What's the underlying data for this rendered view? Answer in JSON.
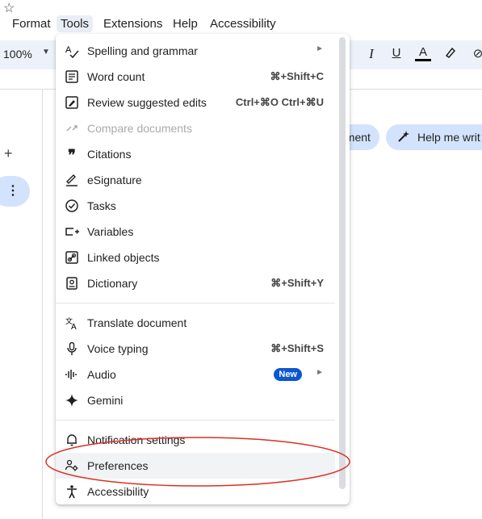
{
  "menubar": {
    "items": [
      {
        "label": "Format"
      },
      {
        "label": "Tools"
      },
      {
        "label": "Extensions"
      },
      {
        "label": "Help"
      },
      {
        "label": "Accessibility"
      }
    ]
  },
  "toolbar": {
    "zoom": "100%"
  },
  "chips": {
    "first": "nment",
    "second": "Help me writ"
  },
  "menu": {
    "items": [
      {
        "label": "Spelling and grammar",
        "icon": "spellcheck-icon"
      },
      {
        "label": "Word count",
        "shortcut": "⌘+Shift+C",
        "icon": "word-count-icon"
      },
      {
        "label": "Review suggested edits",
        "shortcut": "Ctrl+⌘O Ctrl+⌘U",
        "icon": "review-edits-icon"
      },
      {
        "label": "Compare documents",
        "icon": "compare-icon",
        "disabled": true
      },
      {
        "label": "Citations",
        "icon": "citations-icon"
      },
      {
        "label": "eSignature",
        "icon": "signature-icon"
      },
      {
        "label": "Tasks",
        "icon": "tasks-icon"
      },
      {
        "label": "Variables",
        "icon": "variables-icon"
      },
      {
        "label": "Linked objects",
        "icon": "link-icon"
      },
      {
        "label": "Dictionary",
        "shortcut": "⌘+Shift+Y",
        "icon": "dictionary-icon"
      },
      {
        "label": "Translate document",
        "icon": "translate-icon"
      },
      {
        "label": "Voice typing",
        "shortcut": "⌘+Shift+S",
        "icon": "microphone-icon"
      },
      {
        "label": "Audio",
        "badge": "New",
        "icon": "audio-icon"
      },
      {
        "label": "Gemini",
        "icon": "gemini-icon"
      },
      {
        "label": "Notification settings",
        "icon": "bell-icon"
      },
      {
        "label": "Preferences",
        "icon": "preferences-icon",
        "highlighted": true
      },
      {
        "label": "Accessibility",
        "icon": "accessibility-icon"
      }
    ]
  },
  "colors": {
    "annotation": "#d93025",
    "menu_highlight": "#f1f3f4",
    "badge": "#0b57d0",
    "chip": "#d3e3fd"
  }
}
